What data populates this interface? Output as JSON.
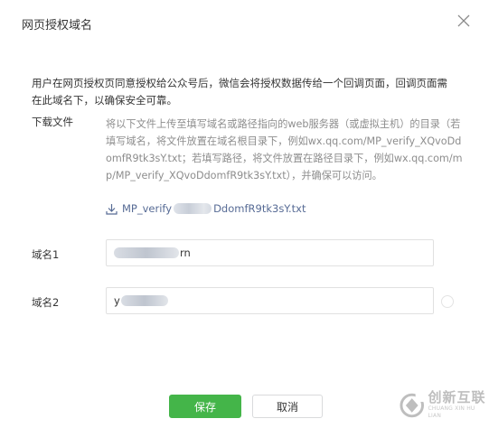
{
  "dialog": {
    "title": "网页授权域名",
    "close_icon": "close-icon"
  },
  "description": "用户在网页授权页同意授权给公众号后，微信会将授权数据传给一个回调页面，回调页面需在此域名下，以确保安全可靠。",
  "download": {
    "label": "下载文件",
    "instruction": "将以下文件上传至填写域名或路径指向的web服务器（或虚拟主机）的目录（若填写域名，将文件放置在域名根目录下，例如wx.qq.com/MP_verify_XQvoDdomfR9tk3sY.txt；若填写路径，将文件放置在路径目录下，例如wx.qq.com/mp/MP_verify_XQvoDdomfR9tk3sY.txt），并确保可以访问。",
    "link_prefix": "MP_verify",
    "link_suffix": "DdomfR9tk3sY.txt",
    "link_icon": "download-icon"
  },
  "fields": [
    {
      "label": "域名1",
      "value_visible": "rn"
    },
    {
      "label": "域名2",
      "value_visible": "y"
    }
  ],
  "buttons": {
    "save": "保存",
    "cancel": "取消"
  },
  "colors": {
    "primary": "#44b549",
    "link": "#576b95",
    "muted_text": "#8d8d8d"
  },
  "watermark": {
    "cn": "创新互联",
    "en": "CHUANG XIN HU LIAN"
  }
}
